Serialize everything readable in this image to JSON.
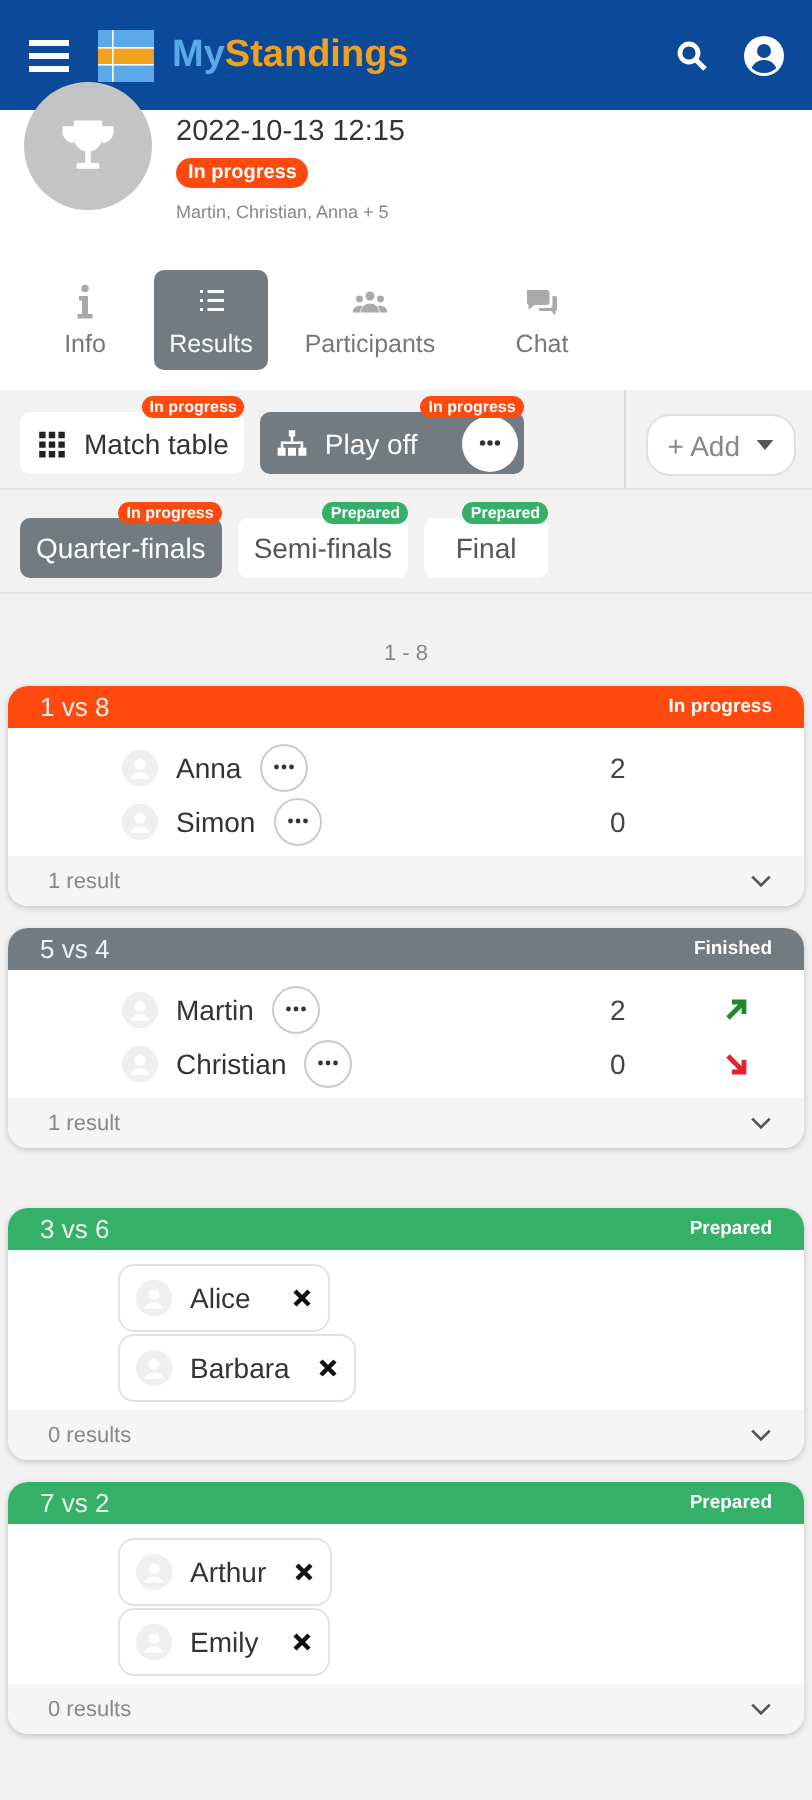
{
  "app_bar": {
    "brand_part_1": "My",
    "brand_part_2": "Standings"
  },
  "event": {
    "datetime": "2022-10-13 12:15",
    "status": {
      "text": "In progress",
      "kind": "in_progress"
    },
    "participants": "Martin, Christian, Anna + 5"
  },
  "tabs": [
    {
      "label": "Info",
      "selected": false
    },
    {
      "label": "Results",
      "selected": true
    },
    {
      "label": "Participants",
      "selected": false
    },
    {
      "label": "Chat",
      "selected": false
    }
  ],
  "views": [
    {
      "label": "Match table",
      "badge": {
        "text": "In progress",
        "kind": "in_progress"
      },
      "selected": false
    },
    {
      "label": "Play off",
      "badge": {
        "text": "In progress",
        "kind": "in_progress"
      },
      "selected": true
    }
  ],
  "add_button": "+ Add",
  "rounds": [
    {
      "label": "Quarter-finals",
      "badge": {
        "text": "In progress",
        "kind": "in_progress"
      },
      "selected": true
    },
    {
      "label": "Semi-finals",
      "badge": {
        "text": "Prepared",
        "kind": "prepared"
      },
      "selected": false
    },
    {
      "label": "Final",
      "badge": {
        "text": "Prepared",
        "kind": "prepared"
      },
      "selected": false
    }
  ],
  "range": "1 - 8",
  "match_groups": [
    [
      {
        "title": "1 vs 8",
        "status": "In progress",
        "kind": "in_progress",
        "footer": "1 result",
        "players": [
          {
            "name": "Anna",
            "score": "2"
          },
          {
            "name": "Simon",
            "score": "0"
          }
        ]
      },
      {
        "title": "5 vs 4",
        "status": "Finished",
        "kind": "finished",
        "footer": "1 result",
        "players": [
          {
            "name": "Martin",
            "score": "2",
            "kind": "win"
          },
          {
            "name": "Christian",
            "score": "0",
            "kind": "loss"
          }
        ]
      }
    ],
    [
      {
        "title": "3 vs 6",
        "status": "Prepared",
        "kind": "prepared",
        "footer": "0 results",
        "players": [
          {
            "name": "Alice",
            "removable": true
          },
          {
            "name": "Barbara",
            "removable": true
          }
        ]
      },
      {
        "title": "7 vs 2",
        "status": "Prepared",
        "kind": "prepared",
        "footer": "0 results",
        "players": [
          {
            "name": "Arthur",
            "removable": true
          },
          {
            "name": "Emily",
            "removable": true
          }
        ]
      }
    ]
  ]
}
